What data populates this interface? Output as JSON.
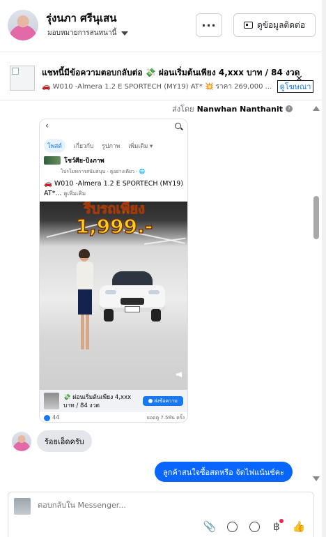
{
  "header": {
    "contact_name": "รุ่งนภา ศรีนุเสน",
    "assign_label": "มอบหมายการสนทนานี้",
    "more_label": "···",
    "contact_info_label": "ดูข้อมูลติดต่อ"
  },
  "banner": {
    "title": "แชทนี้มีข้อความตอบกลับต่อ 💸 ผ่อนเริ่มต้นเพียง 4,xxx บาท / 84 งวด",
    "subtitle": "🚗 W010 -Almera 1.2 E SPORTECH (MY19) AT* 💥 ราคา 269,000 ...",
    "link_label": "ดูโฆษณา",
    "close_label": "✕"
  },
  "thread": {
    "sent_by_prefix": "ส่งโดย",
    "sent_by_name": "Nanwhan Nanthanit",
    "help_icon": "?"
  },
  "post": {
    "back_icon": "‹",
    "tabs": [
      "โพสต์",
      "เกี่ยวกับ",
      "รูปภาพ",
      "เพิ่มเติม ▾"
    ],
    "page_name": "โชว์ศีย-บิงภาพ",
    "page_meta": "โปรโมทการสนับสนุน · ดูอย่างเดียว · 🌐",
    "text_line1": "🚗 W010 -Almera 1.2 E SPORTECH (MY19)",
    "text_line2": "AT*...",
    "see_more": "ดูเพิ่มเติม",
    "promo_text": "รีบรถเพียง",
    "price_text": "1,999.-",
    "ad_text": "💸 ผ่อนเริ่มต้นเพียง 4,xxx บาท / 84 งวด",
    "ad_button": "ส่งข้อความ",
    "like_count": "44",
    "views": "ยอดดู 7.5พัน ครั้ง"
  },
  "messages": {
    "incoming": "ร้อยเอ็ดครับ",
    "outgoing": "ลูกค้าสนใจซื้อสดหรือ จัดไฟแน้นช์คะ"
  },
  "composer": {
    "placeholder": "ตอบกลับใน Messenger...",
    "icons": [
      "paperclip-icon",
      "chat-icon",
      "emoji-icon",
      "baht-icon",
      "like-icon"
    ],
    "paperclip": "📎",
    "baht": "฿",
    "thumb": "👍"
  }
}
